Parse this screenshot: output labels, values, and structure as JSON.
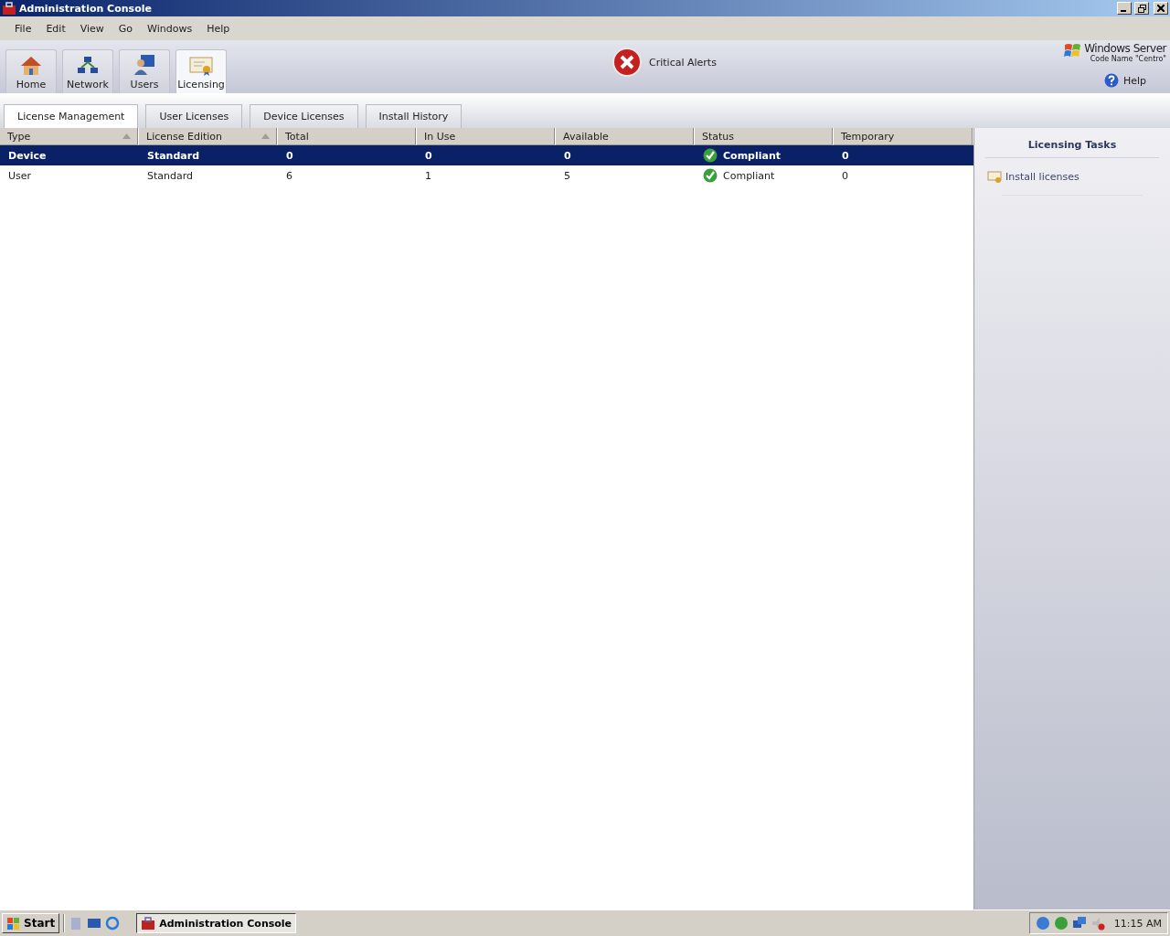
{
  "window": {
    "title": "Administration Console"
  },
  "menu": [
    "File",
    "Edit",
    "View",
    "Go",
    "Windows",
    "Help"
  ],
  "nav_tabs": [
    {
      "label": "Home",
      "kind": "home",
      "selected": false
    },
    {
      "label": "Network",
      "kind": "network",
      "selected": false
    },
    {
      "label": "Users",
      "kind": "users",
      "selected": false
    },
    {
      "label": "Licensing",
      "kind": "licensing",
      "selected": true
    }
  ],
  "alert": {
    "label": "Critical Alerts"
  },
  "logo": {
    "line_1": "Windows Server",
    "line_2": "Code Name \"Centro\""
  },
  "help": "Help",
  "sub_tabs": [
    {
      "label": "License Management",
      "selected": true
    },
    {
      "label": "User Licenses",
      "selected": false
    },
    {
      "label": "Device Licenses",
      "selected": false
    },
    {
      "label": "Install History",
      "selected": false
    }
  ],
  "table": {
    "columns": [
      {
        "label": "Type",
        "sorted": true
      },
      {
        "label": "License Edition",
        "sorted": true
      },
      {
        "label": "Total",
        "sorted": false
      },
      {
        "label": "In Use",
        "sorted": false
      },
      {
        "label": "Available",
        "sorted": false
      },
      {
        "label": "Status",
        "sorted": false
      },
      {
        "label": "Temporary",
        "sorted": false
      }
    ],
    "rows": [
      {
        "selected": true,
        "cells": [
          "Device",
          "Standard",
          "0",
          "0",
          "0",
          "Compliant",
          "0"
        ]
      },
      {
        "selected": false,
        "cells": [
          "User",
          "Standard",
          "6",
          "1",
          "5",
          "Compliant",
          "0"
        ]
      }
    ]
  },
  "tasks": {
    "title": "Licensing Tasks",
    "items": [
      "Install licenses"
    ]
  },
  "taskbar": {
    "start": "Start",
    "windows": [
      "Administration Console"
    ],
    "clock": "11:15 AM"
  }
}
